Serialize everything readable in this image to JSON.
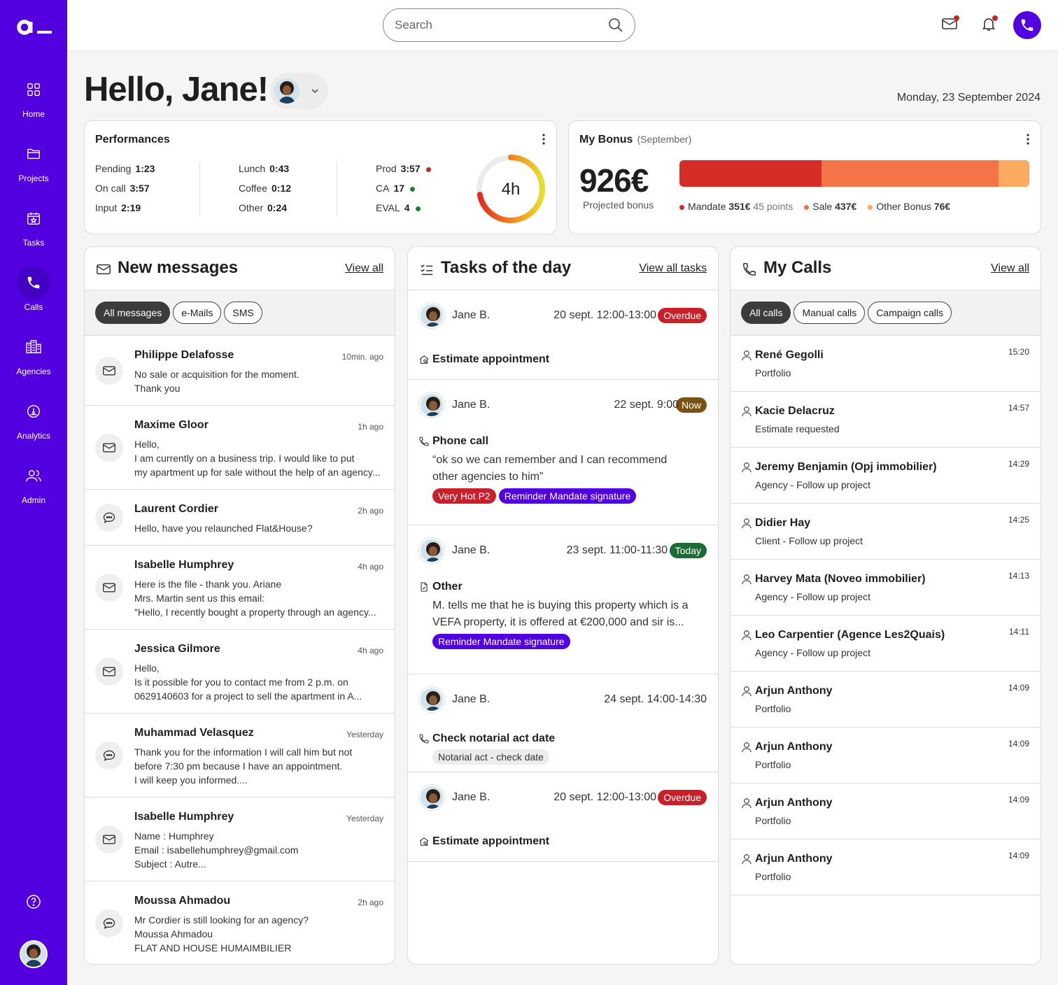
{
  "nav": {
    "items": [
      {
        "label": "Home",
        "icon": "grid-icon"
      },
      {
        "label": "Projects",
        "icon": "folder-icon"
      },
      {
        "label": "Tasks",
        "icon": "calendar-icon"
      },
      {
        "label": "Calls",
        "icon": "phone-icon"
      },
      {
        "label": "Agencies",
        "icon": "buildings-icon"
      },
      {
        "label": "Analytics",
        "icon": "gauge-icon"
      },
      {
        "label": "Admin",
        "icon": "users-icon"
      }
    ],
    "active": "Calls"
  },
  "search": {
    "placeholder": "Search"
  },
  "greeting": "Hello, Jane!",
  "date": "Monday, 23 September 2024",
  "performances": {
    "title": "Performances",
    "col1": [
      {
        "label": "Pending",
        "value": "1:23"
      },
      {
        "label": "On call",
        "value": "3:57"
      },
      {
        "label": "Input",
        "value": "2:19"
      }
    ],
    "col2": [
      {
        "label": "Lunch",
        "value": "0:43"
      },
      {
        "label": "Coffee",
        "value": "0:12"
      },
      {
        "label": "Other",
        "value": "0:24"
      }
    ],
    "col3": [
      {
        "label": "Prod",
        "value": "3:57",
        "dot": "#c62828"
      },
      {
        "label": "CA",
        "value": "17",
        "dot": "#1b7f3a"
      },
      {
        "label": "EVAL",
        "value": "4",
        "dot": "#1b7f3a"
      }
    ],
    "gauge_label": "4h",
    "gauge_progress": 0.72
  },
  "bonus": {
    "title": "My Bonus",
    "period": "(September)",
    "amount": "926€",
    "amount_label": "Projected bonus",
    "segments": [
      {
        "name": "Mandate",
        "value": "351€",
        "extra": "45 points",
        "amount": 351,
        "color": "#d62d27"
      },
      {
        "name": "Sale",
        "value": "437€",
        "extra": "",
        "amount": 437,
        "color": "#f37447"
      },
      {
        "name": "Other Bonus",
        "value": "76€",
        "extra": "",
        "amount": 76,
        "color": "#fbaa60"
      }
    ]
  },
  "messages": {
    "title": "New messages",
    "view_all": "View all",
    "filters": [
      "All messages",
      "e-Mails",
      "SMS"
    ],
    "items": [
      {
        "name": "Philippe Delafosse",
        "time": "10min. ago",
        "type": "mail",
        "lines": [
          "No sale or acquisition for the moment.",
          "Thank you"
        ]
      },
      {
        "name": "Maxime Gloor",
        "time": "1h ago",
        "type": "mail",
        "lines": [
          "Hello,",
          "I am currently on a business trip. I would like to put",
          "my apartment up for sale without the help of an agency..."
        ]
      },
      {
        "name": "Laurent Cordier",
        "time": "2h ago",
        "type": "sms",
        "lines": [
          "Hello, have you relaunched Flat&House?"
        ]
      },
      {
        "name": "Isabelle Humphrey",
        "time": "4h ago",
        "type": "mail",
        "lines": [
          "Here is the file - thank you. Ariane",
          "Mrs. Martin sent us this email:",
          "\"Hello, I recently bought a property through an agency..."
        ]
      },
      {
        "name": "Jessica Gilmore",
        "time": "4h ago",
        "type": "mail",
        "lines": [
          "Hello,",
          "Is it possible for you to contact me from 2 p.m. on",
          "0629140603 for a project to sell the apartment in A..."
        ]
      },
      {
        "name": "Muhammad Velasquez",
        "time": "Yesterday",
        "type": "sms",
        "lines": [
          "Thank you for the information I will call him but not",
          "before 7:30 pm because I have an appointment.",
          "I will keep you informed...."
        ]
      },
      {
        "name": "Isabelle Humphrey",
        "time": "Yesterday",
        "type": "mail",
        "lines": [
          "Name : Humphrey",
          "Email : isabellehumphrey@gmail.com",
          "Subject : Autre..."
        ]
      },
      {
        "name": "Moussa Ahmadou",
        "time": "2h ago",
        "type": "sms",
        "lines": [
          "Mr Cordier is still looking for an agency?",
          "Moussa Ahmadou",
          "FLAT AND HOUSE HUMAIMBILIER"
        ]
      }
    ]
  },
  "tasks": {
    "title": "Tasks of the day",
    "view_all": "View all tasks",
    "items": [
      {
        "who": "Jane B.",
        "when": "20 sept. 12:00-13:00",
        "badge": "Overdue",
        "badge_color": "#c8202a",
        "type": "home",
        "title": "Estimate appointment",
        "desc": [],
        "tags": []
      },
      {
        "who": "Jane B.",
        "when": "22 sept. 9:00",
        "badge": "Now",
        "badge_color": "#7a5312",
        "type": "phone",
        "title": "Phone call",
        "desc": [
          "“ok so we can remember and I can recommend",
          "other agencies to him”"
        ],
        "tags": [
          {
            "label": "Very Hot P2",
            "bg": "#c8202a",
            "fg": "#ffffff"
          },
          {
            "label": "Reminder Mandate signature",
            "bg": "#5200e0",
            "fg": "#ffffff"
          }
        ]
      },
      {
        "who": "Jane B.",
        "when": "23 sept. 11:00-11:30",
        "badge": "Today",
        "badge_color": "#1b6b35",
        "type": "doc",
        "title": "Other",
        "desc": [
          "M. tells me that he is buying this property which is a",
          "VEFA property, it is offered at €200,000 and sir is..."
        ],
        "tags": [
          {
            "label": "Reminder Mandate signature",
            "bg": "#5200e0",
            "fg": "#ffffff"
          }
        ]
      },
      {
        "who": "Jane B.",
        "when": "24 sept. 14:00-14:30",
        "badge": "",
        "badge_color": "",
        "type": "phone",
        "title": "Check notarial act date",
        "desc": [],
        "tags": [
          {
            "label": "Notarial act - check date",
            "bg": "#ececec",
            "fg": "#333333"
          }
        ]
      },
      {
        "who": "Jane B.",
        "when": "20 sept. 12:00-13:00",
        "badge": "Overdue",
        "badge_color": "#c8202a",
        "type": "home",
        "title": "Estimate appointment",
        "desc": [],
        "tags": []
      }
    ]
  },
  "calls": {
    "title": "My Calls",
    "view_all": "View all",
    "filters": [
      "All calls",
      "Manual calls",
      "Campaign calls"
    ],
    "items": [
      {
        "name": "René Gegolli",
        "sub": "Portfolio",
        "time": "15:20"
      },
      {
        "name": "Kacie Delacruz",
        "sub": "Estimate requested",
        "time": "14:57"
      },
      {
        "name": "Jeremy Benjamin (Opj immobilier)",
        "sub": "Agency - Follow up project",
        "time": "14:29"
      },
      {
        "name": "Didier Hay",
        "sub": "Client - Follow up project",
        "time": "14:25"
      },
      {
        "name": "Harvey Mata (Noveo immobilier)",
        "sub": "Agency - Follow up project",
        "time": "14:13"
      },
      {
        "name": "Leo Carpentier (Agence Les2Quais)",
        "sub": "Agency - Follow up project",
        "time": "14:11"
      },
      {
        "name": "Arjun Anthony",
        "sub": "Portfolio",
        "time": "14:09"
      },
      {
        "name": "Arjun Anthony",
        "sub": "Portfolio",
        "time": "14:09"
      },
      {
        "name": "Arjun Anthony",
        "sub": "Portfolio",
        "time": "14:09"
      },
      {
        "name": "Arjun Anthony",
        "sub": "Portfolio",
        "time": "14:09"
      }
    ]
  },
  "colors": {
    "brand": "#5200e0"
  }
}
